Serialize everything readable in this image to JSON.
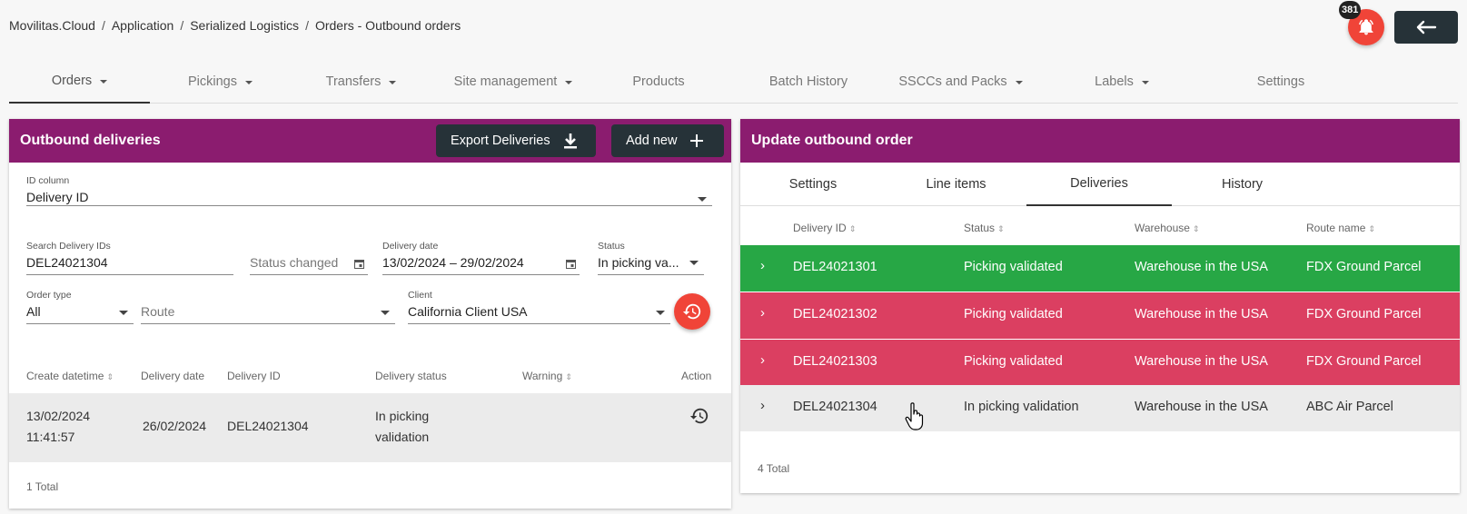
{
  "breadcrumb": [
    "Movilitas.Cloud",
    "Application",
    "Serialized Logistics",
    "Orders - Outbound orders"
  ],
  "notifications": {
    "count": "381",
    "icon": "bell-icon",
    "color": "#f04438"
  },
  "nav": [
    {
      "label": "Orders",
      "dropdown": true,
      "active": true
    },
    {
      "label": "Pickings",
      "dropdown": true
    },
    {
      "label": "Transfers",
      "dropdown": true
    },
    {
      "label": "Site management",
      "dropdown": true
    },
    {
      "label": "Products",
      "dropdown": false
    },
    {
      "label": "Batch History",
      "dropdown": false
    },
    {
      "label": "SSCCs and Packs",
      "dropdown": true
    },
    {
      "label": "Labels",
      "dropdown": true
    },
    {
      "label": "Settings",
      "dropdown": false
    }
  ],
  "left": {
    "title": "Outbound deliveries",
    "export_label": "Export Deliveries",
    "add_label": "Add new",
    "id_column": {
      "label": "ID column",
      "value": "Delivery ID"
    },
    "search": {
      "label": "Search Delivery IDs",
      "value": "DEL24021304"
    },
    "status_changed": {
      "placeholder": "Status changed"
    },
    "delivery_date": {
      "label": "Delivery date",
      "value": "13/02/2024 – 29/02/2024"
    },
    "status": {
      "label": "Status",
      "value": "In picking va..."
    },
    "order_type": {
      "label": "Order type",
      "value": "All"
    },
    "route": {
      "placeholder": "Route"
    },
    "client": {
      "label": "Client",
      "value": "California Client USA"
    },
    "columns": {
      "create_datetime": "Create datetime",
      "delivery_date": "Delivery date",
      "delivery_id": "Delivery ID",
      "delivery_status": "Delivery status",
      "warning": "Warning",
      "action": "Action"
    },
    "row": {
      "create_date": "13/02/2024",
      "create_time": "11:41:57",
      "delivery_date": "26/02/2024",
      "delivery_id": "DEL24021304",
      "status_line1": "In picking",
      "status_line2": "validation"
    },
    "total": "1 Total"
  },
  "right": {
    "title": "Update outbound order",
    "tabs": [
      "Settings",
      "Line items",
      "Deliveries",
      "History"
    ],
    "active_tab": "Deliveries",
    "columns": {
      "delivery_id": "Delivery ID",
      "status": "Status",
      "warehouse": "Warehouse",
      "route_name": "Route name"
    },
    "rows": [
      {
        "id": "DEL24021301",
        "status": "Picking validated",
        "warehouse": "Warehouse in the USA",
        "route": "FDX Ground Parcel",
        "color": "#27a745"
      },
      {
        "id": "DEL24021302",
        "status": "Picking validated",
        "warehouse": "Warehouse in the USA",
        "route": "FDX Ground Parcel",
        "color": "#db3f61"
      },
      {
        "id": "DEL24021303",
        "status": "Picking validated",
        "warehouse": "Warehouse in the USA",
        "route": "FDX Ground Parcel",
        "color": "#db3f61"
      },
      {
        "id": "DEL24021304",
        "status": "In picking validation",
        "warehouse": "Warehouse in the USA",
        "route": "ABC Air Parcel",
        "color": "#ebebeb"
      }
    ],
    "total": "4 Total"
  },
  "colors": {
    "header": "#8b1c6f",
    "button_dark": "#263238",
    "accent_red": "#f04438"
  }
}
